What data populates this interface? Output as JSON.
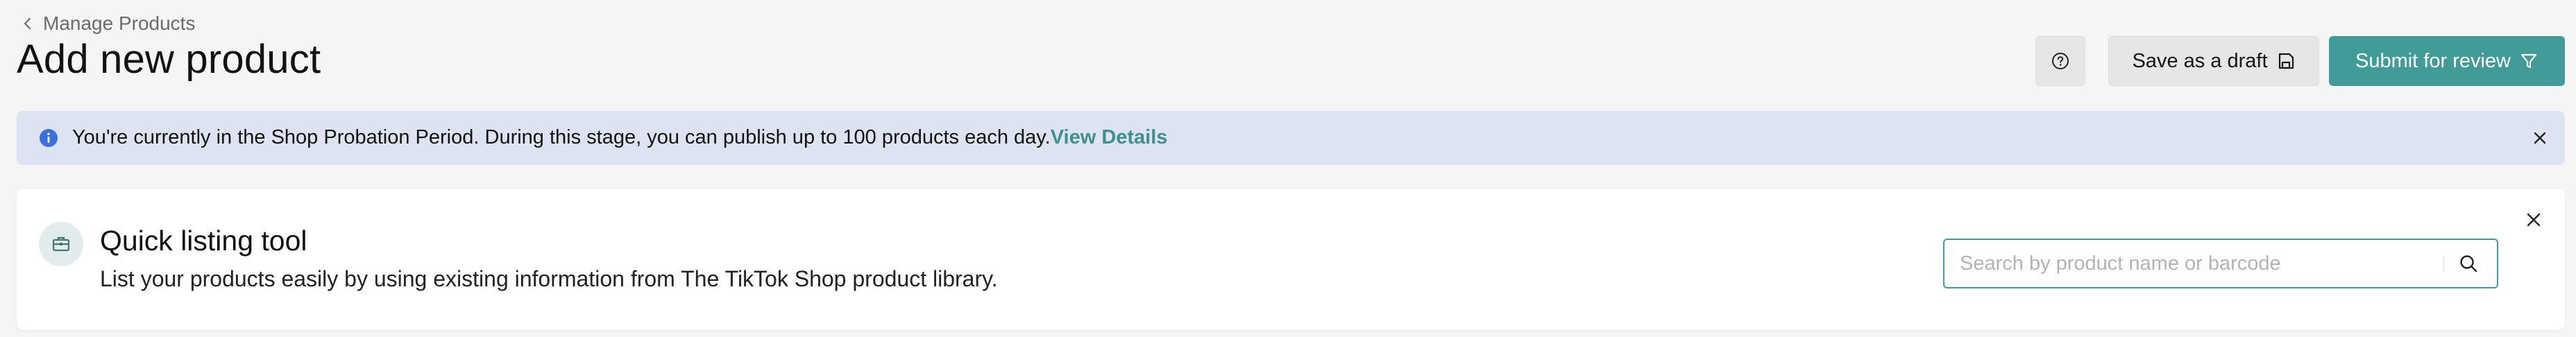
{
  "header": {
    "back_label": "Manage Products",
    "title": "Add new product",
    "help_icon": "help-circle-icon",
    "save_draft_label": "Save as a draft",
    "save_draft_icon": "floppy-disk-icon",
    "submit_label": "Submit for review",
    "submit_icon": "filter-funnel-icon"
  },
  "banner": {
    "icon": "info-icon",
    "message": "You're currently in the Shop Probation Period. During this stage, you can publish up to 100 products each day.",
    "link_label": "View Details",
    "close_icon": "close-icon"
  },
  "quick_listing": {
    "icon": "toolbox-icon",
    "title": "Quick listing tool",
    "description": "List your products easily by using existing information from The TikTok Shop product library.",
    "search_placeholder": "Search by product name or barcode",
    "search_value": "",
    "close_icon": "close-icon"
  },
  "colors": {
    "accent": "#419b98",
    "link": "#3f8f8d",
    "banner_bg": "#dde3f1",
    "info_icon": "#3b6fe0",
    "page_bg": "#f5f5f5"
  }
}
